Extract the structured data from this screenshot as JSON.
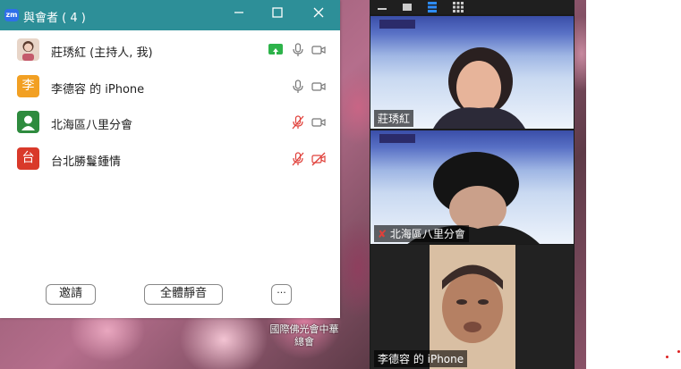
{
  "window": {
    "title": "與會者 ( 4 )"
  },
  "participants": [
    {
      "name": "莊琇紅 (主持人, 我)",
      "avatar_color": "#cfae9a",
      "avatar_text": ""
    },
    {
      "name": "李德容 的 iPhone",
      "avatar_color": "#f2a023",
      "avatar_text": "李"
    },
    {
      "name": "北海區八里分會",
      "avatar_color": "#2e8b3e",
      "avatar_text": ""
    },
    {
      "name": "台北勝鬘鍾情",
      "avatar_color": "#d9392a",
      "avatar_text": "台"
    }
  ],
  "buttons": {
    "invite": "邀請",
    "mute_all": "全體靜音",
    "more": "···"
  },
  "video_tiles": [
    {
      "label": "莊琇紅"
    },
    {
      "label": "北海區八里分會"
    },
    {
      "label": "李德容 的 iPhone"
    }
  ],
  "desktop_labels": {
    "org": "國際佛光會中華總會"
  },
  "colors": {
    "titlebar": "#2d8f98",
    "active_border": "#9acd32",
    "muted_red": "#e0403a"
  }
}
